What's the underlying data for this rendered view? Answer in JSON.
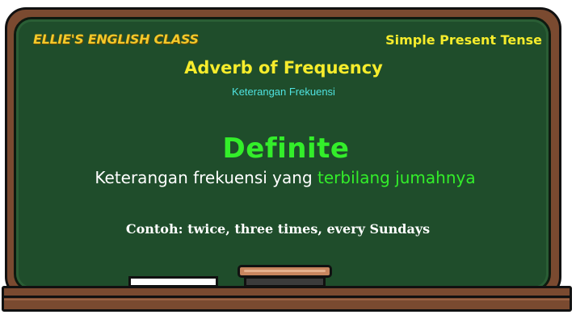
{
  "board": {
    "brand": "ELLIE'S ENGLISH CLASS",
    "topic": "Simple Present Tense",
    "title": "Adverb of Frequency",
    "subtitle": "Keterangan Frekuensi",
    "heading": "Definite",
    "definition_prefix": "Keterangan frekuensi yang",
    "definition_highlight": "terbilang jumahnya",
    "example": "Contoh: twice, three times, every Sundays"
  },
  "colors": {
    "board_green": "#1f4d2b",
    "frame_brown": "#7a4a30",
    "title_yellow": "#f6ec2c",
    "brand_gold": "#f2c82a",
    "subtitle_cyan": "#4fe3e0",
    "accent_green": "#33ee2a",
    "text_white": "#ffffff"
  },
  "icons": {
    "chalk": "chalk-icon",
    "eraser": "eraser-icon"
  }
}
